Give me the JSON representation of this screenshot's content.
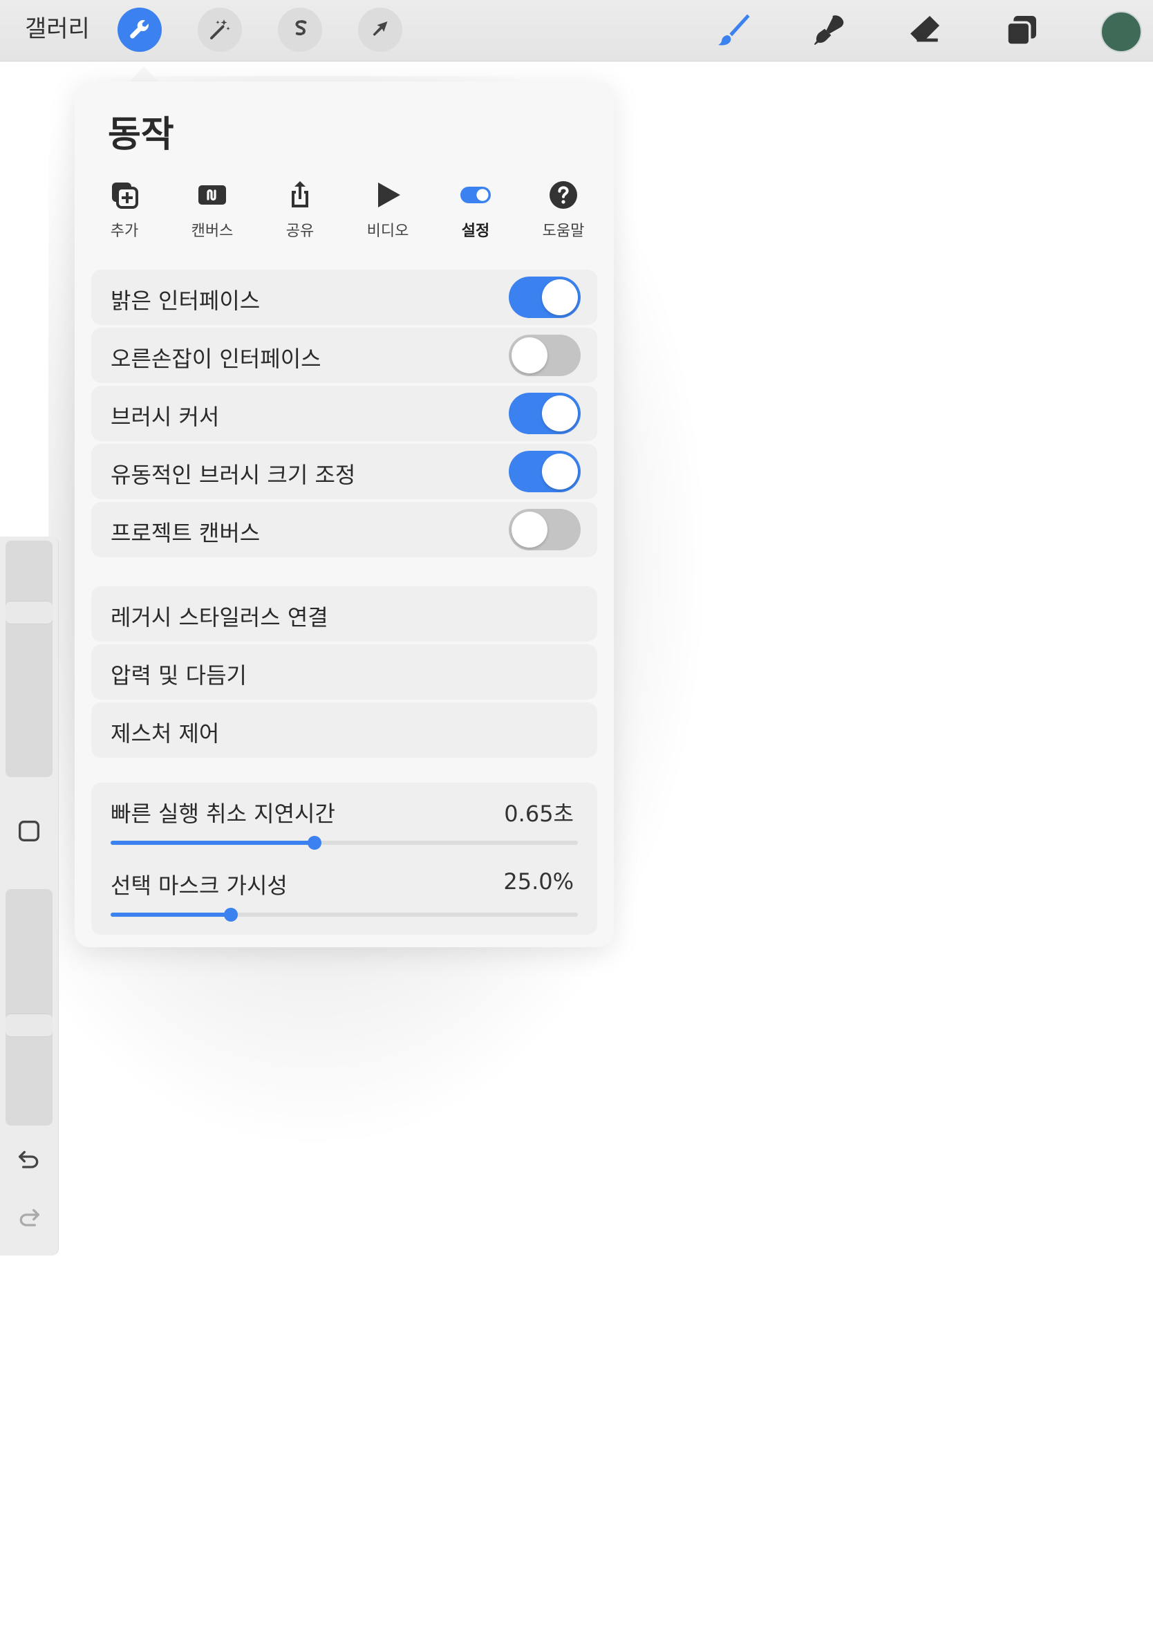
{
  "toolbar": {
    "gallery_label": "갤러리",
    "left_tools": [
      {
        "name": "actions",
        "icon": "wrench-icon",
        "active": true
      },
      {
        "name": "adjustments",
        "icon": "magic-wand-icon",
        "active": false
      },
      {
        "name": "selection",
        "icon": "selection-s-icon",
        "active": false
      },
      {
        "name": "transform",
        "icon": "arrow-cursor-icon",
        "active": false
      }
    ],
    "right_tools": [
      {
        "name": "brush",
        "icon": "brush-icon"
      },
      {
        "name": "smudge",
        "icon": "smudge-icon"
      },
      {
        "name": "eraser",
        "icon": "eraser-icon"
      },
      {
        "name": "layers",
        "icon": "layers-icon"
      }
    ],
    "current_color": "#3f6a58",
    "accent_color": "#3b82f0"
  },
  "panel": {
    "title": "동작",
    "tabs": [
      {
        "label": "추가",
        "icon": "add-icon",
        "active": false
      },
      {
        "label": "캔버스",
        "icon": "canvas-icon",
        "active": false
      },
      {
        "label": "공유",
        "icon": "share-icon",
        "active": false
      },
      {
        "label": "비디오",
        "icon": "play-icon",
        "active": false
      },
      {
        "label": "설정",
        "icon": "toggle-icon",
        "active": true
      },
      {
        "label": "도움말",
        "icon": "help-icon",
        "active": false
      }
    ],
    "toggles": [
      {
        "label": "밝은 인터페이스",
        "on": true
      },
      {
        "label": "오른손잡이 인터페이스",
        "on": false
      },
      {
        "label": "브러시 커서",
        "on": true
      },
      {
        "label": "유동적인 브러시 크기 조정",
        "on": true
      },
      {
        "label": "프로젝트 캔버스",
        "on": false
      }
    ],
    "links": [
      {
        "label": "레거시 스타일러스 연결"
      },
      {
        "label": "압력 및 다듬기"
      },
      {
        "label": "제스처 제어"
      }
    ],
    "sliders": [
      {
        "label": "빠른 실행 취소 지연시간",
        "value_text": "0.65초",
        "fraction": 0.436
      },
      {
        "label": "선택 마스크 가시성",
        "value_text": "25.0%",
        "fraction": 0.258
      }
    ]
  },
  "sidebar": {
    "brush_size_level": 0.72,
    "opacity_level": 0.42,
    "modify_button_icon": "square-icon",
    "undo_icon": "undo-icon",
    "redo_icon": "redo-icon"
  }
}
